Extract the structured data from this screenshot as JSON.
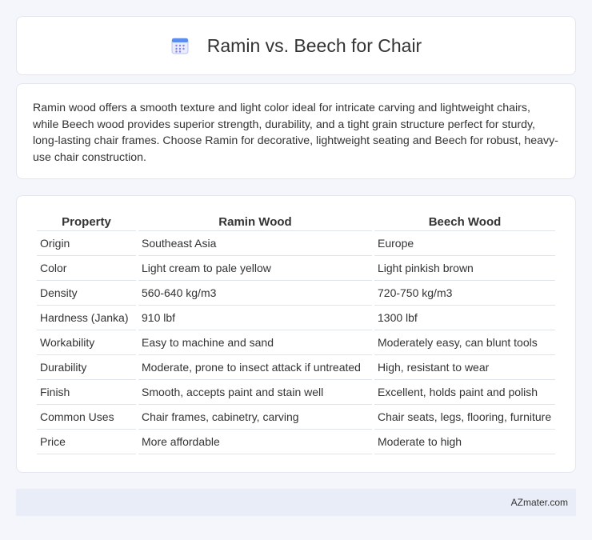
{
  "header": {
    "title": "Ramin vs. Beech for Chair",
    "icon": "calendar-icon"
  },
  "summary": {
    "text": "Ramin wood offers a smooth texture and light color ideal for intricate carving and lightweight chairs, while Beech wood provides superior strength, durability, and a tight grain structure perfect for sturdy, long-lasting chair frames. Choose Ramin for decorative, lightweight seating and Beech for robust, heavy-use chair construction."
  },
  "table": {
    "headers": [
      "Property",
      "Ramin Wood",
      "Beech Wood"
    ],
    "rows": [
      [
        "Origin",
        "Southeast Asia",
        "Europe"
      ],
      [
        "Color",
        "Light cream to pale yellow",
        "Light pinkish brown"
      ],
      [
        "Density",
        "560-640 kg/m3",
        "720-750 kg/m3"
      ],
      [
        "Hardness (Janka)",
        "910 lbf",
        "1300 lbf"
      ],
      [
        "Workability",
        "Easy to machine and sand",
        "Moderately easy, can blunt tools"
      ],
      [
        "Durability",
        "Moderate, prone to insect attack if untreated",
        "High, resistant to wear"
      ],
      [
        "Finish",
        "Smooth, accepts paint and stain well",
        "Excellent, holds paint and polish"
      ],
      [
        "Common Uses",
        "Chair frames, cabinetry, carving",
        "Chair seats, legs, flooring, furniture"
      ],
      [
        "Price",
        "More affordable",
        "Moderate to high"
      ]
    ]
  },
  "footer": {
    "site": "AZmater.com"
  },
  "colors": {
    "background": "#f4f6fb",
    "card": "#ffffff",
    "footer_bg": "#e8edf7",
    "icon_blue": "#5b8def",
    "icon_purple": "#8a7ee8"
  }
}
